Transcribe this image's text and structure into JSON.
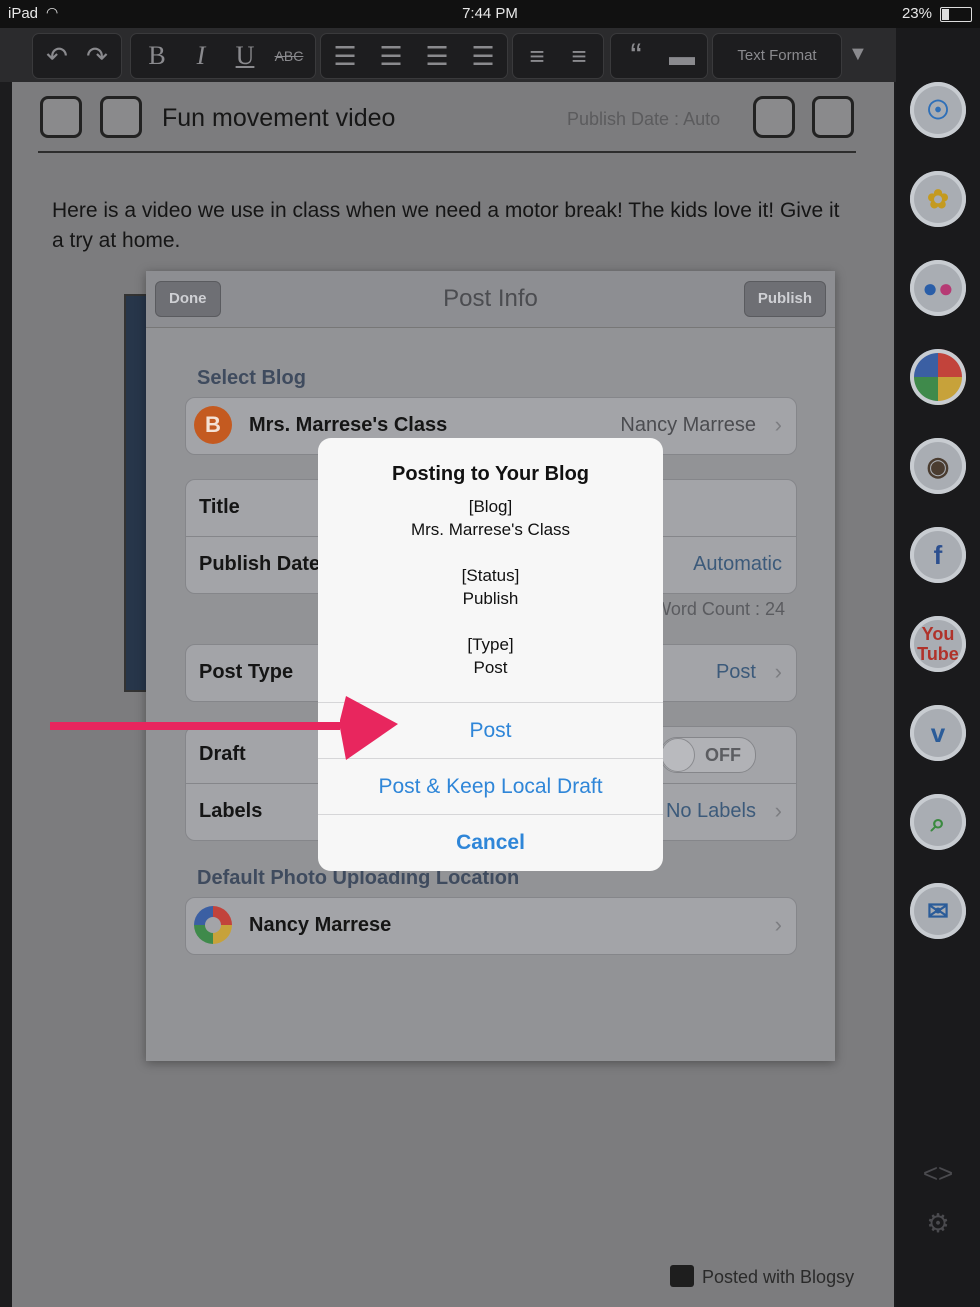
{
  "status_bar": {
    "device": "iPad",
    "time": "7:44 PM",
    "battery": "23%"
  },
  "toolbar": {
    "text_format": "Text Format"
  },
  "editor": {
    "title": "Fun movement video",
    "publish_date": "Publish Date : Auto",
    "body": "Here is a video we use in class when we need a motor break! The kids love it! Give it a try at home.",
    "footer": "Posted with Blogsy"
  },
  "post_info": {
    "title": "Post Info",
    "done": "Done",
    "publish": "Publish",
    "select_blog_header": "Select Blog",
    "blog_name": "Mrs. Marrese's Class",
    "blog_author": "Nancy Marrese",
    "title_label": "Title",
    "publish_date_label": "Publish Date",
    "publish_date_value": "Automatic",
    "word_count": "Word Count : 24",
    "post_type_label": "Post Type",
    "post_type_value": "Post",
    "draft_label": "Draft",
    "draft_value": "OFF",
    "labels_label": "Labels",
    "labels_value": "No Labels",
    "photo_location_header": "Default Photo Uploading Location",
    "photo_account": "Nancy Marrese"
  },
  "dialog": {
    "title": "Posting to Your Blog",
    "blog_tag": "[Blog]",
    "blog_value": "Mrs. Marrese's Class",
    "status_tag": "[Status]",
    "status_value": "Publish",
    "type_tag": "[Type]",
    "type_value": "Post",
    "post_button": "Post",
    "post_keep_button": "Post & Keep Local Draft",
    "cancel_button": "Cancel"
  },
  "sidebar_icons": [
    "safari-icon",
    "sunflower-icon",
    "flickr-icon",
    "picasa-icon",
    "instagram-icon",
    "facebook-icon",
    "youtube-icon",
    "vimeo-icon",
    "search-icon",
    "mail-icon"
  ],
  "colors": {
    "accent": "#2f86d8",
    "arrow": "#e8265e"
  }
}
